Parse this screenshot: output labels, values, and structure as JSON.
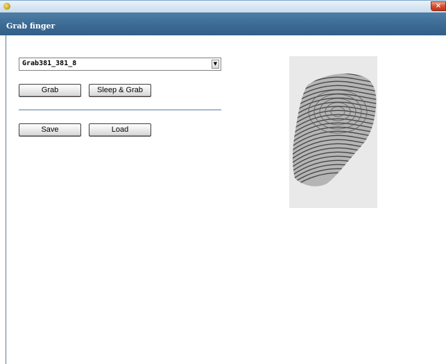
{
  "window": {
    "title": "Grab finger",
    "close_glyph": "×",
    "app_icon": "app-icon",
    "colors": {
      "titlebar": "#3b6a94",
      "accent": "#4f7ea6",
      "close": "#d8502f"
    }
  },
  "combo": {
    "value": "Grab381_381_8",
    "arrow_glyph": "▼"
  },
  "buttons": {
    "grab": "Grab",
    "sleep_grab": "Sleep & Grab",
    "save": "Save",
    "load": "Load"
  },
  "image": {
    "icon": "fingerprint-image"
  }
}
